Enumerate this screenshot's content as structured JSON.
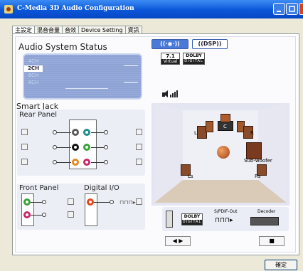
{
  "window": {
    "title": "C-Media 3D Audio Configuration"
  },
  "tabs": [
    {
      "label": "主設定",
      "active": true
    },
    {
      "label": "混音音量"
    },
    {
      "label": "音效"
    },
    {
      "label": "Device Setting"
    },
    {
      "label": "資訊"
    }
  ],
  "status": {
    "title": "Audio System Status",
    "channels": [
      "2CH",
      "4CH",
      "6CH",
      "8CH"
    ],
    "selected_channel": "2CH"
  },
  "smart_jack": {
    "title": "Smart Jack",
    "rear_panel": "Rear Panel",
    "front_panel": "Front Panel",
    "digital_io": "Digital I/O"
  },
  "mode_buttons": {
    "speaker": "((·◉·))",
    "dsp": "((DSP))"
  },
  "logos": {
    "virtual": "7.1",
    "virtual_sub": "Virtual",
    "dolby_top": "DOLBY",
    "dolby_sub": "DIGITAL"
  },
  "room": {
    "labels": {
      "left": "L",
      "center": "C",
      "right": "R",
      "left_surround": "Ls",
      "right_surround": "Rs",
      "subwoofer": "Sub-woofer"
    }
  },
  "spdif": {
    "out_label": "S/PDIF-Out",
    "decoder_label": "Decoder",
    "dolby": "DOLBY",
    "dolby_sub": "DIGITAL"
  },
  "controls": {
    "play": "◀ ▶",
    "stop": "■"
  },
  "ok_label": "確定",
  "colors": {
    "titlebar": "#0a56d8",
    "accent": "#3a5fb0",
    "screen": "#8ea3d3"
  }
}
